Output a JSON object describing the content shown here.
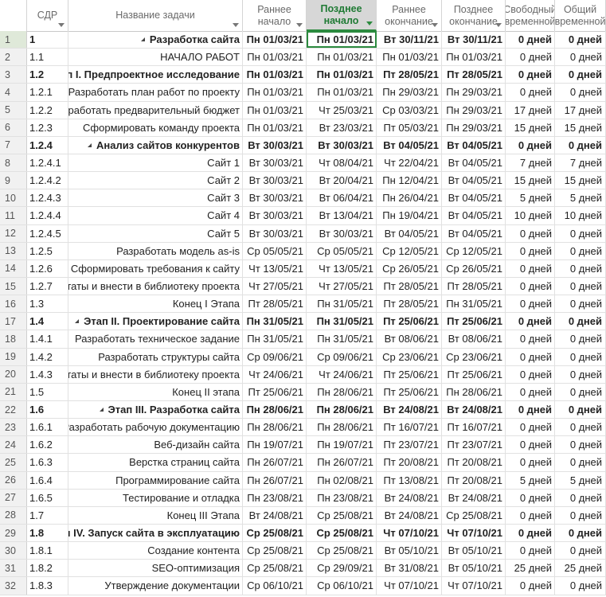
{
  "columns": {
    "wbs": "СДР",
    "name": "Название задачи",
    "early_start": "Раннее начало",
    "late_start": "Позднее начало",
    "early_finish": "Раннее окончание",
    "late_finish": "Позднее окончание",
    "free_slack": "Свободный временной",
    "total_slack": "Общий временной"
  },
  "colors": {
    "accent": "#2b8a3e",
    "header_text": "#6a6a6a",
    "active_header_bg": "#d7d7d7"
  },
  "rows": [
    {
      "id": "1",
      "wbs": "1",
      "name": "Разработка сайта",
      "es": "Пн 01/03/21",
      "ls": "Пн 01/03/21",
      "ef": "Вт 30/11/21",
      "lf": "Вт 30/11/21",
      "fs": "0 дней",
      "ts": "0 дней",
      "bold": true,
      "summary": true
    },
    {
      "id": "2",
      "wbs": "1.1",
      "name": "НАЧАЛО РАБОТ",
      "es": "Пн 01/03/21",
      "ls": "Пн 01/03/21",
      "ef": "Пн 01/03/21",
      "lf": "Пн 01/03/21",
      "fs": "0 дней",
      "ts": "0 дней"
    },
    {
      "id": "3",
      "wbs": "1.2",
      "name": "Этап I. Предпроектное исследование",
      "es": "Пн 01/03/21",
      "ls": "Пн 01/03/21",
      "ef": "Пт 28/05/21",
      "lf": "Пт 28/05/21",
      "fs": "0 дней",
      "ts": "0 дней",
      "bold": true,
      "summary": true
    },
    {
      "id": "4",
      "wbs": "1.2.1",
      "name": "Разработать план работ по проекту",
      "es": "Пн 01/03/21",
      "ls": "Пн 01/03/21",
      "ef": "Пн 29/03/21",
      "lf": "Пн 29/03/21",
      "fs": "0 дней",
      "ts": "0 дней"
    },
    {
      "id": "5",
      "wbs": "1.2.2",
      "name": "Разработать предварительный бюджет",
      "es": "Пн 01/03/21",
      "ls": "Чт 25/03/21",
      "ef": "Ср 03/03/21",
      "lf": "Пн 29/03/21",
      "fs": "17 дней",
      "ts": "17 дней"
    },
    {
      "id": "6",
      "wbs": "1.2.3",
      "name": "Сформировать команду проекта",
      "es": "Пн 01/03/21",
      "ls": "Вт 23/03/21",
      "ef": "Пт 05/03/21",
      "lf": "Пн 29/03/21",
      "fs": "15 дней",
      "ts": "15 дней"
    },
    {
      "id": "7",
      "wbs": "1.2.4",
      "name": "Анализ сайтов конкурентов",
      "es": "Вт 30/03/21",
      "ls": "Вт 30/03/21",
      "ef": "Вт 04/05/21",
      "lf": "Вт 04/05/21",
      "fs": "0 дней",
      "ts": "0 дней",
      "bold": true,
      "summary": true
    },
    {
      "id": "8",
      "wbs": "1.2.4.1",
      "name": "Сайт 1",
      "es": "Вт 30/03/21",
      "ls": "Чт 08/04/21",
      "ef": "Чт 22/04/21",
      "lf": "Вт 04/05/21",
      "fs": "7 дней",
      "ts": "7 дней"
    },
    {
      "id": "9",
      "wbs": "1.2.4.2",
      "name": "Сайт 2",
      "es": "Вт 30/03/21",
      "ls": "Вт 20/04/21",
      "ef": "Пн 12/04/21",
      "lf": "Вт 04/05/21",
      "fs": "15 дней",
      "ts": "15 дней"
    },
    {
      "id": "10",
      "wbs": "1.2.4.3",
      "name": "Сайт 3",
      "es": "Вт 30/03/21",
      "ls": "Вт 06/04/21",
      "ef": "Пн 26/04/21",
      "lf": "Вт 04/05/21",
      "fs": "5 дней",
      "ts": "5 дней"
    },
    {
      "id": "11",
      "wbs": "1.2.4.4",
      "name": "Сайт 4",
      "es": "Вт 30/03/21",
      "ls": "Вт 13/04/21",
      "ef": "Пн 19/04/21",
      "lf": "Вт 04/05/21",
      "fs": "10 дней",
      "ts": "10 дней"
    },
    {
      "id": "12",
      "wbs": "1.2.4.5",
      "name": "Сайт 5",
      "es": "Вт 30/03/21",
      "ls": "Вт 30/03/21",
      "ef": "Вт 04/05/21",
      "lf": "Вт 04/05/21",
      "fs": "0 дней",
      "ts": "0 дней"
    },
    {
      "id": "13",
      "wbs": "1.2.5",
      "name": "Разработать модель as-is",
      "es": "Ср 05/05/21",
      "ls": "Ср 05/05/21",
      "ef": "Ср 12/05/21",
      "lf": "Ср 12/05/21",
      "fs": "0 дней",
      "ts": "0 дней"
    },
    {
      "id": "14",
      "wbs": "1.2.6",
      "name": "Сформировать требования к сайту",
      "es": "Чт 13/05/21",
      "ls": "Чт 13/05/21",
      "ef": "Ср 26/05/21",
      "lf": "Ср 26/05/21",
      "fs": "0 дней",
      "ts": "0 дней"
    },
    {
      "id": "15",
      "wbs": "1.2.7",
      "name": "Сформировать результаты и внести в библиотеку проекта",
      "es": "Чт 27/05/21",
      "ls": "Чт 27/05/21",
      "ef": "Пт 28/05/21",
      "lf": "Пт 28/05/21",
      "fs": "0 дней",
      "ts": "0 дней"
    },
    {
      "id": "16",
      "wbs": "1.3",
      "name": "Конец I Этапа",
      "es": "Пт 28/05/21",
      "ls": "Пн 31/05/21",
      "ef": "Пт 28/05/21",
      "lf": "Пн 31/05/21",
      "fs": "0 дней",
      "ts": "0 дней"
    },
    {
      "id": "17",
      "wbs": "1.4",
      "name": "Этап II. Проектирование сайта",
      "es": "Пн 31/05/21",
      "ls": "Пн 31/05/21",
      "ef": "Пт 25/06/21",
      "lf": "Пт 25/06/21",
      "fs": "0 дней",
      "ts": "0 дней",
      "bold": true,
      "summary": true
    },
    {
      "id": "18",
      "wbs": "1.4.1",
      "name": "Разработать техническое задание",
      "es": "Пн 31/05/21",
      "ls": "Пн 31/05/21",
      "ef": "Вт 08/06/21",
      "lf": "Вт 08/06/21",
      "fs": "0 дней",
      "ts": "0 дней"
    },
    {
      "id": "19",
      "wbs": "1.4.2",
      "name": "Разработать структуры сайта",
      "es": "Ср 09/06/21",
      "ls": "Ср 09/06/21",
      "ef": "Ср 23/06/21",
      "lf": "Ср 23/06/21",
      "fs": "0 дней",
      "ts": "0 дней"
    },
    {
      "id": "20",
      "wbs": "1.4.3",
      "name": "Сформировать результаты и внести в библиотеку проекта",
      "es": "Чт 24/06/21",
      "ls": "Чт 24/06/21",
      "ef": "Пт 25/06/21",
      "lf": "Пт 25/06/21",
      "fs": "0 дней",
      "ts": "0 дней"
    },
    {
      "id": "21",
      "wbs": "1.5",
      "name": "Конец II этапа",
      "es": "Пт 25/06/21",
      "ls": "Пн 28/06/21",
      "ef": "Пт 25/06/21",
      "lf": "Пн 28/06/21",
      "fs": "0 дней",
      "ts": "0 дней"
    },
    {
      "id": "22",
      "wbs": "1.6",
      "name": "Этап III. Разработка сайта",
      "es": "Пн 28/06/21",
      "ls": "Пн 28/06/21",
      "ef": "Вт 24/08/21",
      "lf": "Вт 24/08/21",
      "fs": "0 дней",
      "ts": "0 дней",
      "bold": true,
      "summary": true
    },
    {
      "id": "23",
      "wbs": "1.6.1",
      "name": "Разработать рабочую документацию",
      "es": "Пн 28/06/21",
      "ls": "Пн 28/06/21",
      "ef": "Пт 16/07/21",
      "lf": "Пт 16/07/21",
      "fs": "0 дней",
      "ts": "0 дней"
    },
    {
      "id": "24",
      "wbs": "1.6.2",
      "name": "Веб-дизайн сайта",
      "es": "Пн 19/07/21",
      "ls": "Пн 19/07/21",
      "ef": "Пт 23/07/21",
      "lf": "Пт 23/07/21",
      "fs": "0 дней",
      "ts": "0 дней"
    },
    {
      "id": "25",
      "wbs": "1.6.3",
      "name": "Верстка страниц сайта",
      "es": "Пн 26/07/21",
      "ls": "Пн 26/07/21",
      "ef": "Пт 20/08/21",
      "lf": "Пт 20/08/21",
      "fs": "0 дней",
      "ts": "0 дней"
    },
    {
      "id": "26",
      "wbs": "1.6.4",
      "name": "Программирование сайта",
      "es": "Пн 26/07/21",
      "ls": "Пн 02/08/21",
      "ef": "Пт 13/08/21",
      "lf": "Пт 20/08/21",
      "fs": "5 дней",
      "ts": "5 дней"
    },
    {
      "id": "27",
      "wbs": "1.6.5",
      "name": "Тестирование и отладка",
      "es": "Пн 23/08/21",
      "ls": "Пн 23/08/21",
      "ef": "Вт 24/08/21",
      "lf": "Вт 24/08/21",
      "fs": "0 дней",
      "ts": "0 дней"
    },
    {
      "id": "28",
      "wbs": "1.7",
      "name": "Конец III Этапа",
      "es": "Вт 24/08/21",
      "ls": "Ср 25/08/21",
      "ef": "Вт 24/08/21",
      "lf": "Ср 25/08/21",
      "fs": "0 дней",
      "ts": "0 дней"
    },
    {
      "id": "29",
      "wbs": "1.8",
      "name": "Этап IV. Запуск сайта в эксплуатацию",
      "es": "Ср 25/08/21",
      "ls": "Ср 25/08/21",
      "ef": "Чт 07/10/21",
      "lf": "Чт 07/10/21",
      "fs": "0 дней",
      "ts": "0 дней",
      "bold": true,
      "summary": true
    },
    {
      "id": "30",
      "wbs": "1.8.1",
      "name": "Создание контента",
      "es": "Ср 25/08/21",
      "ls": "Ср 25/08/21",
      "ef": "Вт 05/10/21",
      "lf": "Вт 05/10/21",
      "fs": "0 дней",
      "ts": "0 дней"
    },
    {
      "id": "31",
      "wbs": "1.8.2",
      "name": "SEO-оптимизация",
      "es": "Ср 25/08/21",
      "ls": "Ср 29/09/21",
      "ef": "Вт 31/08/21",
      "lf": "Вт 05/10/21",
      "fs": "25 дней",
      "ts": "25 дней"
    },
    {
      "id": "32",
      "wbs": "1.8.3",
      "name": "Утверждение документации",
      "es": "Ср 06/10/21",
      "ls": "Ср 06/10/21",
      "ef": "Чт 07/10/21",
      "lf": "Чт 07/10/21",
      "fs": "0 дней",
      "ts": "0 дней"
    }
  ]
}
